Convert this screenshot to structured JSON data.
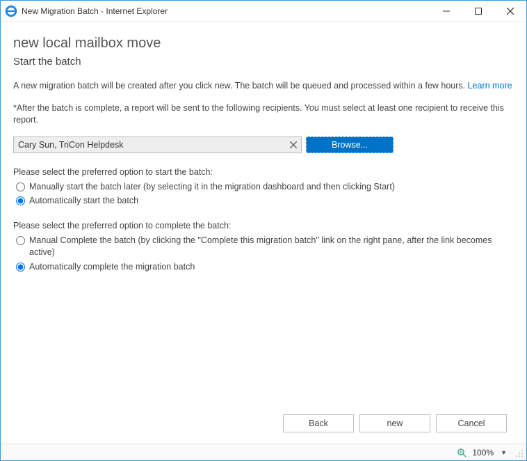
{
  "window": {
    "title": "New Migration Batch - Internet Explorer"
  },
  "page": {
    "heading": "new local mailbox move",
    "subheading": "Start the batch",
    "intro_pre": "A new migration batch will be created after you click new. The batch will be queued and processed within a few hours. ",
    "learn_more": "Learn more",
    "recipient_note": "*After the batch is complete, a report will be sent to the following recipients. You must select at least one recipient to receive this report.",
    "recipient_value": "Cary Sun, TriCon Helpdesk",
    "browse_label": "Browse...",
    "start_prompt": "Please select the preferred option to start the batch:",
    "start_options": {
      "manual": "Manually start the batch later (by selecting it in the migration dashboard and then clicking Start)",
      "auto": "Automatically start the batch"
    },
    "complete_prompt": "Please select the preferred option to complete the batch:",
    "complete_options": {
      "manual": "Manual Complete the batch (by clicking the \"Complete this migration batch\" link on the right pane, after the link becomes active)",
      "auto": "Automatically complete the migration batch"
    }
  },
  "footer": {
    "back": "Back",
    "new": "new",
    "cancel": "Cancel"
  },
  "status": {
    "zoom": "100%"
  }
}
